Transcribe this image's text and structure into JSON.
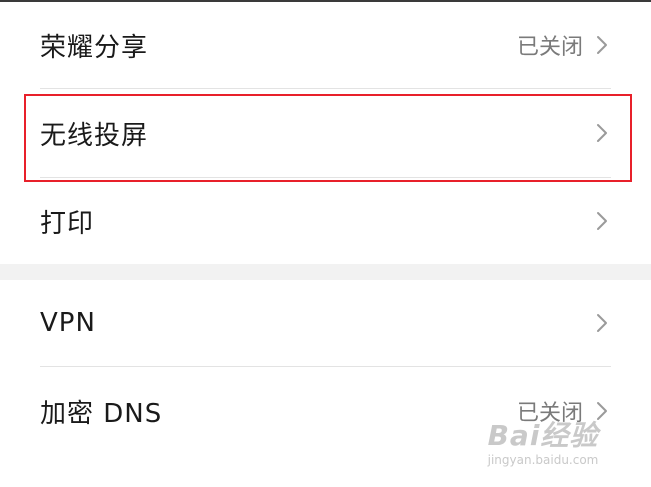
{
  "settings": {
    "items": [
      {
        "label": "荣耀分享",
        "value": "已关闭"
      },
      {
        "label": "无线投屏",
        "value": ""
      },
      {
        "label": "打印",
        "value": ""
      },
      {
        "label": "VPN",
        "value": ""
      },
      {
        "label": "加密 DNS",
        "value": "已关闭"
      }
    ]
  },
  "highlight": {
    "color": "#e8202a",
    "target": "无线投屏"
  },
  "watermark": {
    "logo_text": "Bai经验",
    "url_text": "jingyan.baidu.com"
  },
  "icons": {
    "row_chevron": "chevron-right-icon"
  },
  "colors": {
    "divider": "#e3e3e3",
    "section_gap": "#f2f2f2",
    "value_text": "#7a7a7a"
  }
}
